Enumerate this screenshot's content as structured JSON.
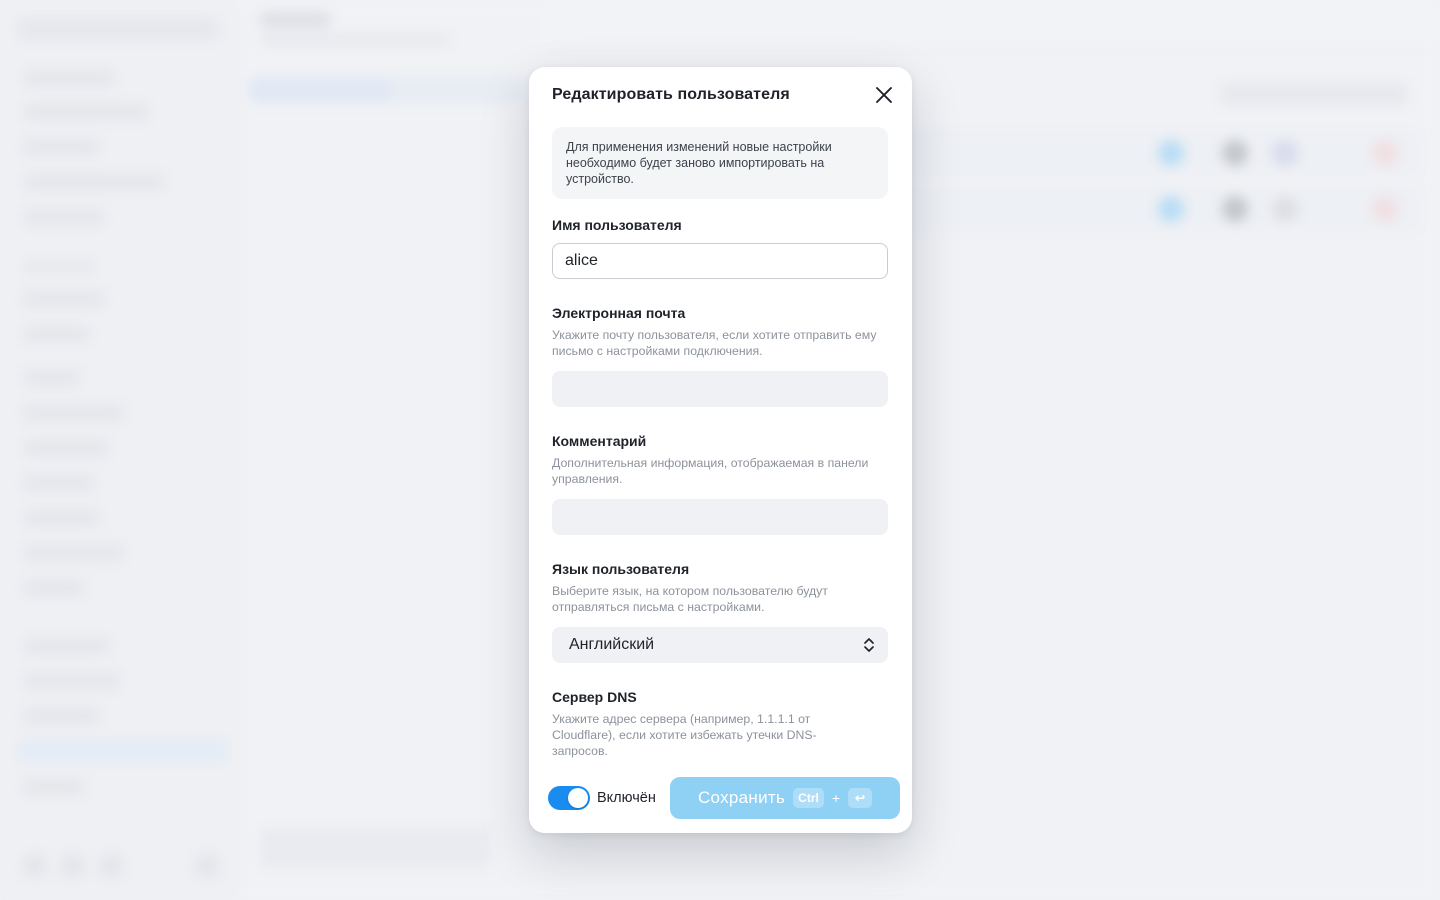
{
  "modal": {
    "title": "Редактировать пользователя",
    "notice": "Для применения изменений новые настройки необходимо будет заново импортировать на устройство.",
    "fields": {
      "username": {
        "label": "Имя пользователя",
        "value": "alice"
      },
      "email": {
        "label": "Электронная почта",
        "hint": "Укажите почту пользователя, если хотите отправить ему письмо с настройками подключения.",
        "value": ""
      },
      "comment": {
        "label": "Комментарий",
        "hint": "Дополнительная информация, отображаемая в панели управления.",
        "value": ""
      },
      "language": {
        "label": "Язык пользователя",
        "hint": "Выберите язык, на котором пользователю будут отправляться письма с настройками.",
        "value": "Английский"
      },
      "dns": {
        "label": "Сервер DNS",
        "hint": "Укажите адрес сервера (например, 1.1.1.1 от Cloudflare), если хотите избежать утечки DNS-запросов."
      }
    },
    "footer": {
      "toggle_label": "Включён",
      "toggle_on": true,
      "save_label": "Сохранить",
      "shortcut_ctrl": "Ctrl",
      "shortcut_plus": "+",
      "shortcut_enter": "↩"
    }
  },
  "colors": {
    "accent": "#1a8cf0",
    "save_button": "#8fd0f5",
    "input_fill": "#f0f1f4"
  }
}
